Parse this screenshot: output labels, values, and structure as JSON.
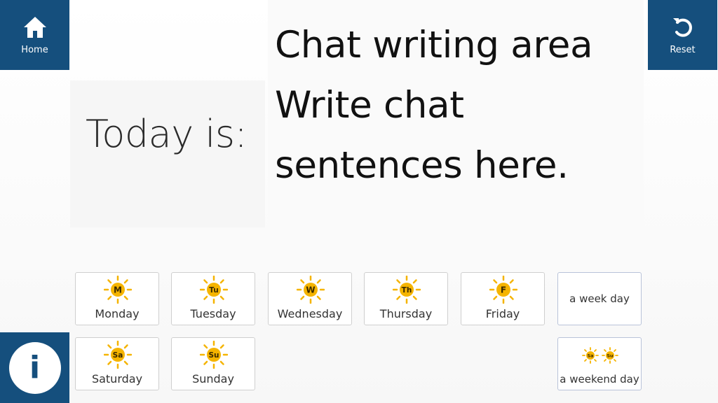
{
  "header": {
    "home_label": "Home",
    "reset_label": "Reset"
  },
  "today": {
    "label": "Today is:"
  },
  "chat": {
    "lines": [
      "Chat writing area",
      "Write chat",
      "sentences here."
    ]
  },
  "days": [
    {
      "abbr": "M",
      "name": "Monday"
    },
    {
      "abbr": "Tu",
      "name": "Tuesday"
    },
    {
      "abbr": "W",
      "name": "Wednesday"
    },
    {
      "abbr": "Th",
      "name": "Thursday"
    },
    {
      "abbr": "F",
      "name": "Friday"
    },
    {
      "abbr": "Sa",
      "name": "Saturday"
    },
    {
      "abbr": "Su",
      "name": "Sunday"
    }
  ],
  "categories": {
    "weekday": "a week day",
    "weekend": "a weekend day",
    "weekend_icons": [
      "Sa",
      "Su"
    ]
  },
  "info": {
    "symbol": "i"
  },
  "colors": {
    "brand": "#154f7d",
    "sun": "#f5b400"
  }
}
